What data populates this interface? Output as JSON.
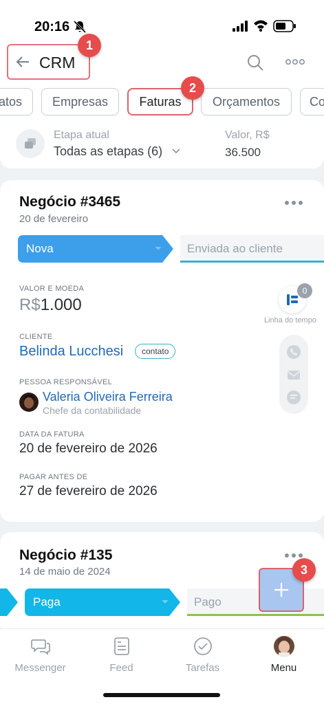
{
  "status_bar": {
    "time": "20:16"
  },
  "header": {
    "title": "CRM",
    "step_badges": [
      "1",
      "2",
      "3"
    ]
  },
  "tabs": [
    {
      "label": "atos",
      "active": false
    },
    {
      "label": "Empresas",
      "active": false
    },
    {
      "label": "Faturas",
      "active": true
    },
    {
      "label": "Orçamentos",
      "active": false
    },
    {
      "label": "Co",
      "active": false
    }
  ],
  "summary": {
    "stage_label": "Etapa atual",
    "stage_value": "Todas as etapas (6)",
    "value_label": "Valor, R$",
    "value_amount": "36.500"
  },
  "deals": [
    {
      "title": "Negócio #3465",
      "date": "20 de fevereiro",
      "current_stage": "Nova",
      "next_stage": "Enviada ao cliente",
      "amount_label": "VALOR E MOEDA",
      "currency": "R$",
      "amount": "1.000",
      "client_label": "CLIENTE",
      "client_name": "Belinda Lucchesi",
      "client_tag": "contato",
      "responsible_label": "PESSOA RESPONSÁVEL",
      "responsible_name": "Valeria Oliveira Ferreira",
      "responsible_role": "Chefe da contabilidade",
      "invoice_date_label": "DATA DA FATURA",
      "invoice_date": "20 de fevereiro de 2026",
      "due_date_label": "PAGAR ANTES DE",
      "due_date": "27 de fevereiro de 2026",
      "timeline_label": "Linha do tempo",
      "timeline_count": "0",
      "colors": {
        "stage": "#3d9fea",
        "next_underline": "#3ab0c9"
      }
    },
    {
      "title": "Negócio #135",
      "date": "14 de maio de 2024",
      "current_stage": "Paga",
      "next_stage": "Pago",
      "colors": {
        "stage": "#12b6e8",
        "next_underline": "#8bc34a"
      }
    }
  ],
  "bottom_nav": [
    {
      "label": "Messenger",
      "icon": "messenger-icon",
      "active": false
    },
    {
      "label": "Feed",
      "icon": "feed-icon",
      "active": false
    },
    {
      "label": "Tarefas",
      "icon": "tasks-icon",
      "active": false
    },
    {
      "label": "Menu",
      "icon": "avatar",
      "active": true
    }
  ],
  "colors": {
    "accent_red": "#e74c4c",
    "link": "#2068b8"
  }
}
